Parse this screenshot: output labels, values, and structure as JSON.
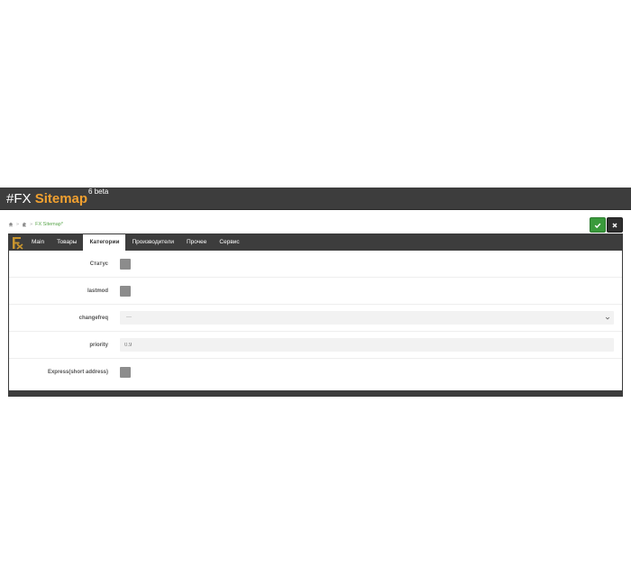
{
  "header": {
    "brand_prefix": "#FX ",
    "brand_name": "Sitemap",
    "version": "6 beta"
  },
  "breadcrumb": {
    "home_icon": "home-icon",
    "puzzle_icon": "puzzle-icon",
    "separator": "»",
    "current": "FX Sitemap*"
  },
  "actions": {
    "save_icon": "check-icon",
    "close_icon": "close-icon"
  },
  "tabs": [
    {
      "label": "Main"
    },
    {
      "label": "Товары"
    },
    {
      "label": "Категории"
    },
    {
      "label": "Производители"
    },
    {
      "label": "Прочее"
    },
    {
      "label": "Сервис"
    }
  ],
  "active_tab": "Категории",
  "form": {
    "status": {
      "label": "Статус"
    },
    "lastmod": {
      "label": "lastmod"
    },
    "changefreq": {
      "label": "changefreq",
      "value": "---"
    },
    "priority": {
      "label": "priority",
      "value": "0.9"
    },
    "express": {
      "label": "Express(short address)"
    }
  },
  "colors": {
    "header_bg": "#3d3d3d",
    "brand_accent": "#f0a030",
    "save_green": "#3a9a3c",
    "checkbox_gray": "#8c8c8c"
  }
}
